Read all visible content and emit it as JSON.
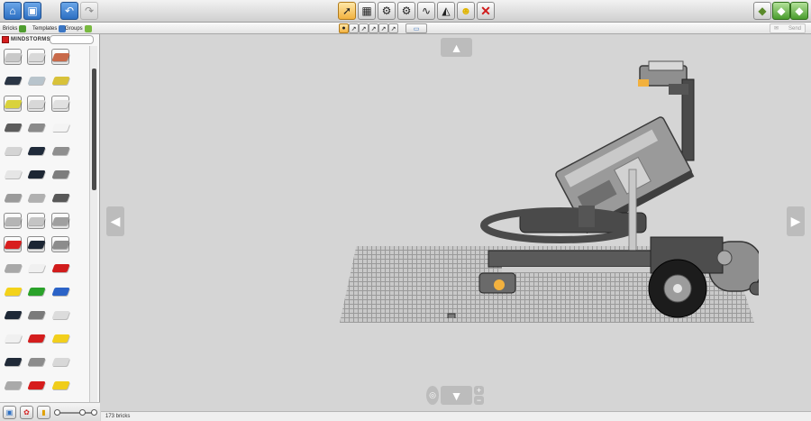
{
  "toolbar": {
    "left_buttons": [
      {
        "name": "home-button",
        "icon": "house-icon"
      },
      {
        "name": "save-button",
        "icon": "floppy-disk-icon"
      },
      {
        "name": "undo-button",
        "icon": "undo-arrow-icon"
      },
      {
        "name": "redo-button",
        "icon": "redo-arrow-icon",
        "disabled": true
      }
    ],
    "tools": [
      {
        "name": "select-tool-button",
        "icon": "cursor-icon",
        "active": true
      },
      {
        "name": "clone-tool-button",
        "icon": "clone-brick-icon"
      },
      {
        "name": "hinge-tool-button",
        "icon": "hinge-icon"
      },
      {
        "name": "hinge-align-tool-button",
        "icon": "hinge-align-icon"
      },
      {
        "name": "flex-tool-button",
        "icon": "flex-icon"
      },
      {
        "name": "paint-tool-button",
        "icon": "paint-bucket-icon"
      },
      {
        "name": "hide-tool-button",
        "icon": "minifig-head-icon"
      },
      {
        "name": "delete-tool-button",
        "icon": "delete-x-icon"
      }
    ],
    "right_buttons": [
      {
        "name": "build-mode-button",
        "icon": "build-mode-icon"
      },
      {
        "name": "view-mode-button",
        "icon": "view-mode-icon"
      },
      {
        "name": "guide-mode-button",
        "icon": "guide-mode-icon"
      }
    ]
  },
  "subbar": {
    "tabs": [
      {
        "label": "Bricks",
        "color": "#4f9d2f"
      },
      {
        "label": "Templates",
        "color": "#3b76c4"
      },
      {
        "label": "Groups",
        "color": "#79b941"
      }
    ],
    "send_label": "Send",
    "sub_tool_count": 6
  },
  "panel": {
    "brand": "MINDSTORMS",
    "brick_rows": [
      [
        "#c9c9c9",
        "#d9d9d9",
        "#c86a4a"
      ],
      [
        "#2a3545",
        "#b8c4cc",
        "#d8c23a"
      ],
      [
        "#d9d23c",
        "#d8d8d8",
        "#e0e0e0"
      ],
      [
        "#5c5c5c",
        "#8a8a8a",
        "#f4f4f4"
      ],
      [
        "#d4d4d4",
        "#1f2a3a",
        "#8f8f8f"
      ],
      [
        "#e6e6e6",
        "#1d2633",
        "#7d7d7d"
      ],
      [
        "#9a9a9a",
        "#b0b0b0",
        "#585858"
      ],
      [
        "#b5b5b5",
        "#c4c4c4",
        "#9f9f9f"
      ],
      [
        "#d81f1f",
        "#1b2533",
        "#8c8c8c"
      ],
      [
        "#a8a8a8",
        "#f0f0f0",
        "#d11c1c"
      ],
      [
        "#f3d21a",
        "#2aa22a",
        "#2b63c7"
      ],
      [
        "#1e2836",
        "#7a7a7a",
        "#dcdcdc"
      ],
      [
        "#f0f0f0",
        "#d41d1d",
        "#f2cf1c"
      ],
      [
        "#202a38",
        "#8c8c8c",
        "#d8d8d8"
      ],
      [
        "#a9a9a9",
        "#d61c1c",
        "#f0cd1a"
      ]
    ],
    "boxed_rows": [
      0,
      2,
      7,
      8
    ]
  },
  "status": {
    "brick_count": "173 bricks"
  },
  "colors": {
    "canvas_bg": "#d5d5d5",
    "nxt_gray": "#8a8a8a",
    "beam_dark": "#3f3f3f",
    "wheel_black": "#1c1c1c",
    "accent_orange": "#f2b13e"
  }
}
